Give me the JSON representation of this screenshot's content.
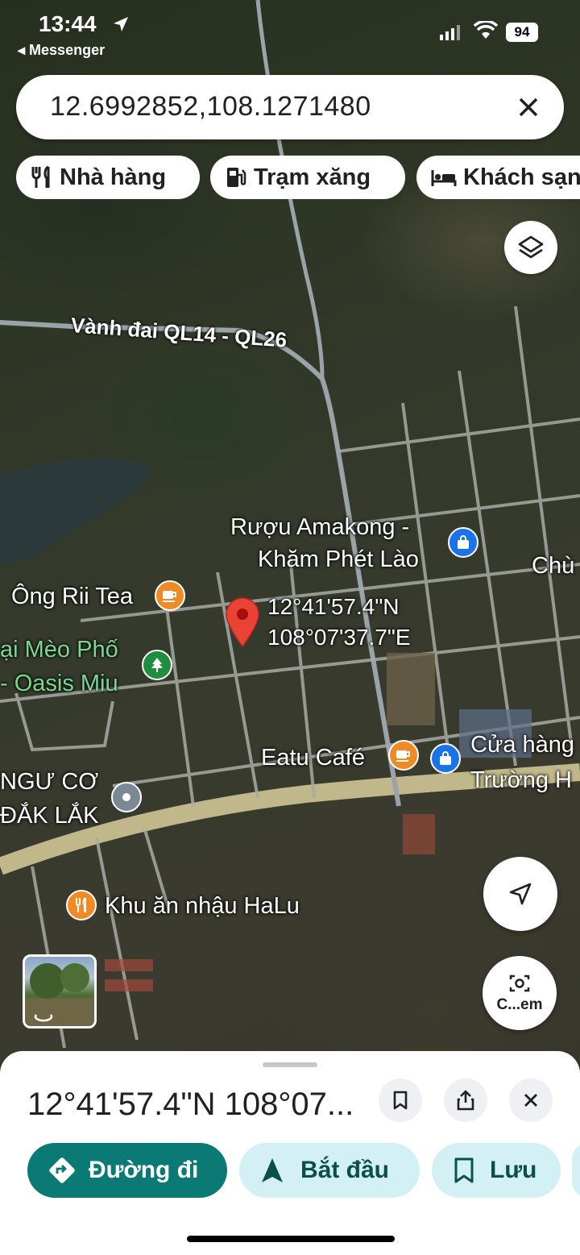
{
  "status_bar": {
    "time": "13:44",
    "back_app": "◂ Messenger",
    "battery": "94"
  },
  "search": {
    "value": "12.6992852,108.1271480"
  },
  "chips": [
    {
      "label": "Nhà hàng",
      "icon": "restaurant-icon"
    },
    {
      "label": "Trạm xăng",
      "icon": "gas-station-icon"
    },
    {
      "label": "Khách sạn",
      "icon": "hotel-icon"
    }
  ],
  "map": {
    "roads": {
      "ring_road": "Vành đai QL14 - QL26"
    },
    "pois": {
      "ruou_line1": "Rượu Amakong -",
      "ruou_line2": "Khăm Phét Lào",
      "chu": "Chù",
      "ong_rii": "Ông Rii Tea",
      "meo_line1": "ại Mèo Phố",
      "meo_line2": "- Oasis Miu",
      "eatu": "Eatu Café",
      "cua_hang_line1": "Cửa hàng",
      "cua_hang_line2": "Trường H",
      "ngu_line1": "NGƯ CƠ",
      "ngu_line2": "ĐẮK LẮK",
      "halu": "Khu ăn nhậu HaLu"
    },
    "pin_label_line1": "12°41'57.4\"N",
    "pin_label_line2": "108°07'37.7\"E",
    "camera_label": "C...em"
  },
  "sheet": {
    "title": "12°41'57.4\"N 108°07...",
    "actions": {
      "directions": "Đường đi",
      "start": "Bắt đầu",
      "save": "Lưu"
    }
  },
  "colors": {
    "primary": "#0b7a75",
    "secondary_bg": "#d3f1f4",
    "pin": "#ea4335",
    "orange": "#f08a24",
    "blue_poi": "#1a73e8",
    "green_poi": "#1e8e3e"
  }
}
